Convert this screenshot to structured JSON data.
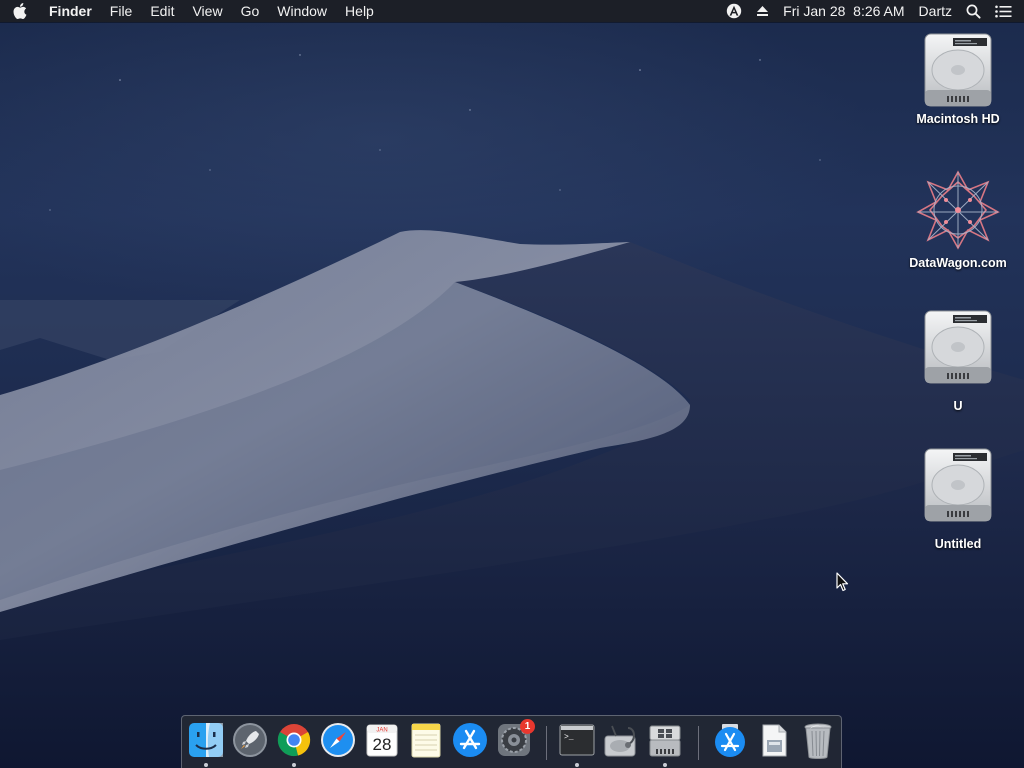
{
  "menubar": {
    "app_name": "Finder",
    "menus": [
      "File",
      "Edit",
      "View",
      "Go",
      "Window",
      "Help"
    ],
    "status": {
      "date_time": "Fri Jan 28  8:26 AM",
      "user": "Dartz"
    }
  },
  "desktop": {
    "icons": [
      {
        "label": "Macintosh HD",
        "icon": "hard-drive-icon"
      },
      {
        "label": "DataWagon.com",
        "icon": "datawagon-disk-icon"
      },
      {
        "label": "U",
        "icon": "hard-drive-icon"
      },
      {
        "label": "Untitled",
        "icon": "hard-drive-icon"
      }
    ]
  },
  "dock": {
    "items": [
      {
        "name": "Finder",
        "icon": "finder-icon",
        "running": true
      },
      {
        "name": "Launchpad",
        "icon": "launchpad-icon",
        "running": false
      },
      {
        "name": "Google Chrome",
        "icon": "chrome-icon",
        "running": true
      },
      {
        "name": "Safari",
        "icon": "safari-icon",
        "running": false
      },
      {
        "name": "Calendar",
        "icon": "calendar-icon",
        "running": false,
        "month": "JAN",
        "day": "28"
      },
      {
        "name": "Notes",
        "icon": "notes-icon",
        "running": false
      },
      {
        "name": "App Store",
        "icon": "app-store-icon",
        "running": false
      },
      {
        "name": "System Preferences",
        "icon": "system-preferences-icon",
        "running": false,
        "badge": "1"
      },
      {
        "name": "Terminal",
        "icon": "terminal-icon",
        "running": true,
        "prompt": ">_"
      },
      {
        "name": "Disk Utility",
        "icon": "disk-utility-icon",
        "running": false
      },
      {
        "name": "Boot Camp Assistant",
        "icon": "bootcamp-icon",
        "running": true
      },
      {
        "name": "Applications",
        "icon": "applications-folder-icon",
        "running": false
      },
      {
        "name": "Documents",
        "icon": "document-stack-icon",
        "running": false
      },
      {
        "name": "Trash",
        "icon": "trash-icon",
        "running": false
      }
    ]
  },
  "colors": {
    "menubar_bg": "#1c1e24",
    "badge_red": "#e8372e",
    "wallpaper_sky": "#1b2a4c"
  }
}
